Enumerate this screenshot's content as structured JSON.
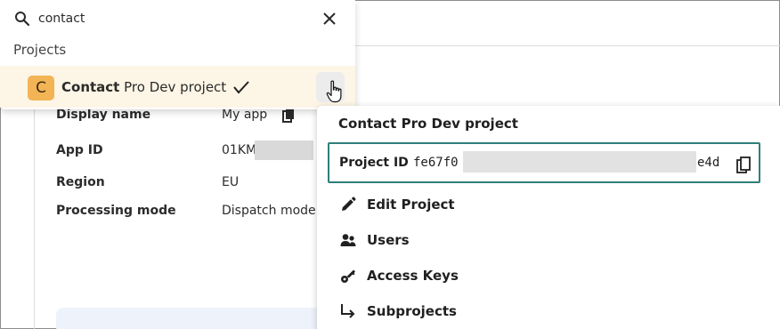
{
  "search": {
    "value": "contact",
    "placeholder": ""
  },
  "dropdown": {
    "section_heading": "Projects",
    "project": {
      "avatar_letter": "C",
      "name_match": "Contact",
      "name_rest": " Pro Dev project"
    }
  },
  "details": {
    "display_name_label": "Display name",
    "display_name_value": "My app",
    "app_id_label": "App ID",
    "app_id_value": "01KM",
    "region_label": "Region",
    "region_value": "EU",
    "processing_mode_label": "Processing mode",
    "processing_mode_value": "Dispatch mode"
  },
  "menu": {
    "title": "Contact Pro Dev project",
    "project_id_label": "Project ID",
    "project_id_start": "fe67f0",
    "project_id_end": "e4d",
    "items": [
      {
        "label": "Edit Project",
        "icon": "pencil-icon"
      },
      {
        "label": "Users",
        "icon": "users-icon"
      },
      {
        "label": "Access Keys",
        "icon": "key-icon"
      },
      {
        "label": "Subprojects",
        "icon": "subdirectory-arrow-icon"
      }
    ]
  },
  "colors": {
    "accent_teal": "#2f7f7a",
    "avatar_orange": "#f3b455",
    "selected_row": "#fdf5e6"
  }
}
